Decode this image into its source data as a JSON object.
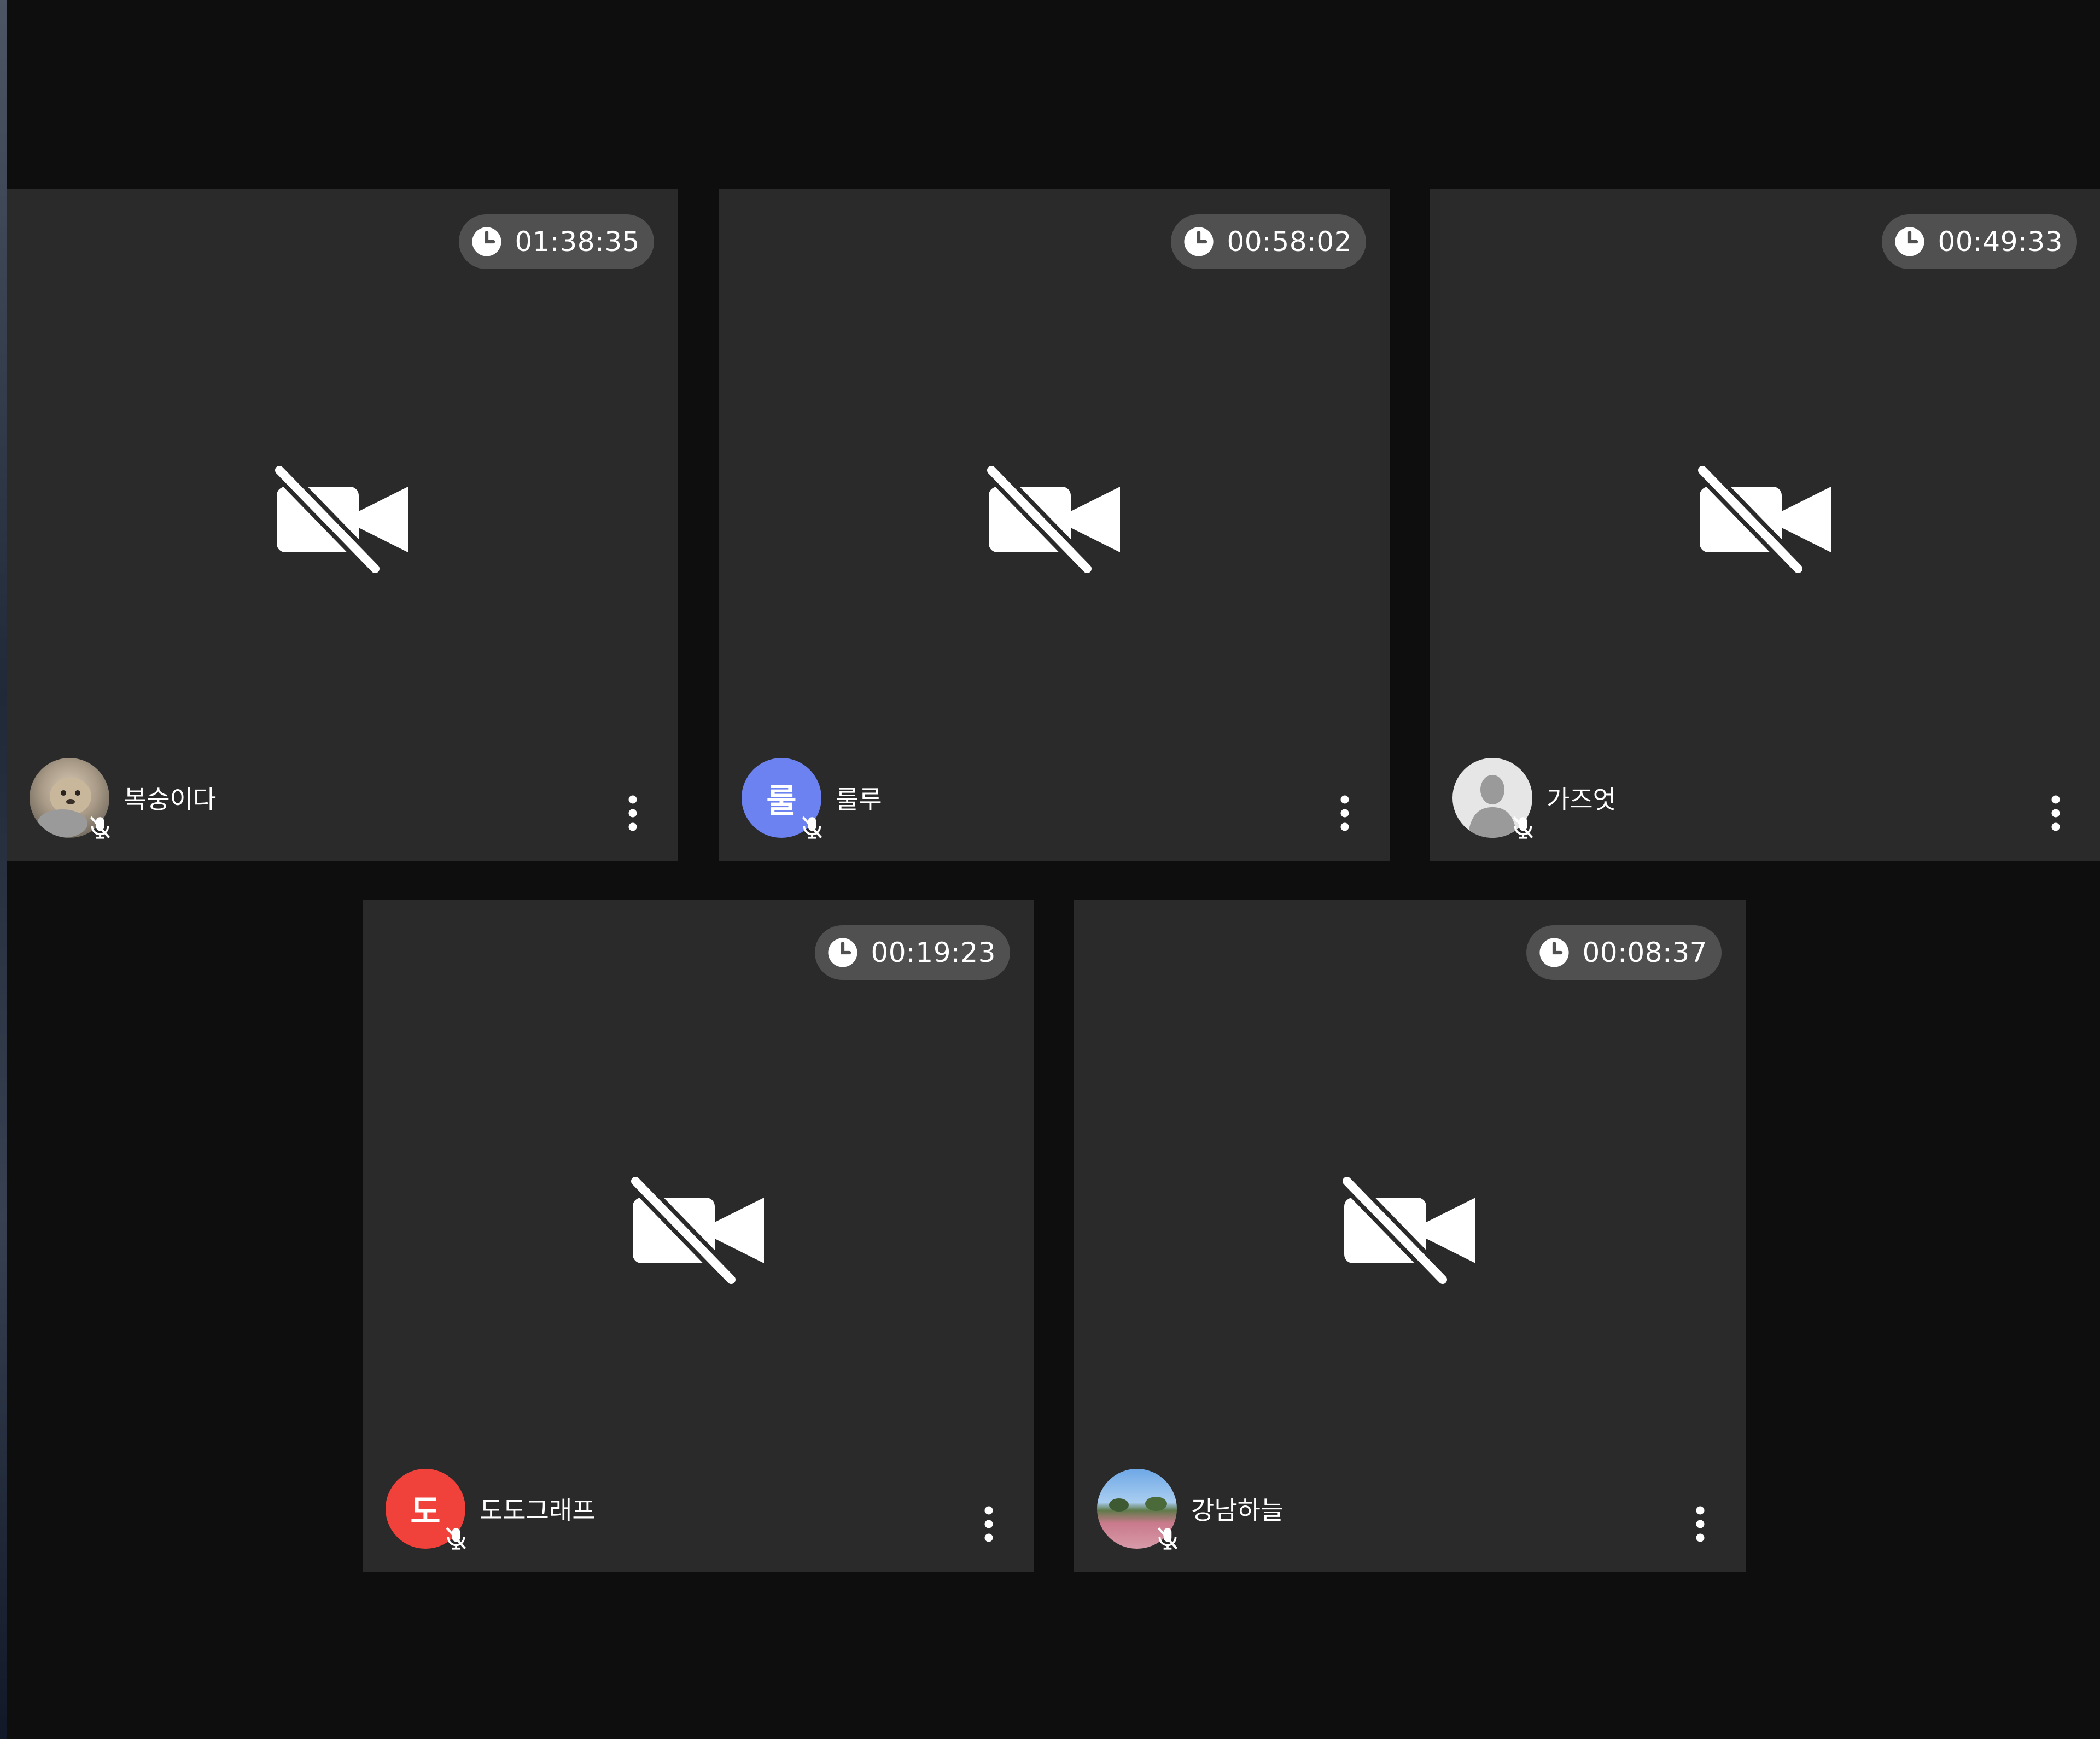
{
  "participants": [
    {
      "name": "복숭이다",
      "timer": "01:38:35",
      "avatar": {
        "type": "photo",
        "subject": "otter"
      }
    },
    {
      "name": "룰루",
      "timer": "00:58:02",
      "avatar": {
        "type": "initial",
        "initial": "룰",
        "color": "#6b82f0"
      }
    },
    {
      "name": "가즈엇",
      "timer": "00:49:33",
      "avatar": {
        "type": "default",
        "color": "#e5e5e5"
      }
    },
    {
      "name": "도도그래프",
      "timer": "00:19:23",
      "avatar": {
        "type": "initial",
        "initial": "도",
        "color": "#f0423a"
      }
    },
    {
      "name": "강남하늘",
      "timer": "00:08:37",
      "avatar": {
        "type": "photo",
        "subject": "field-sky"
      }
    }
  ],
  "icons": {
    "timer": "clock-icon",
    "video": "camera-off-icon",
    "mic": "mic-off-icon",
    "menu": "more-vertical-icon"
  },
  "colors": {
    "background": "#0e0e0e",
    "tile": "#2a2a2b",
    "timer_pill": "#505050"
  }
}
